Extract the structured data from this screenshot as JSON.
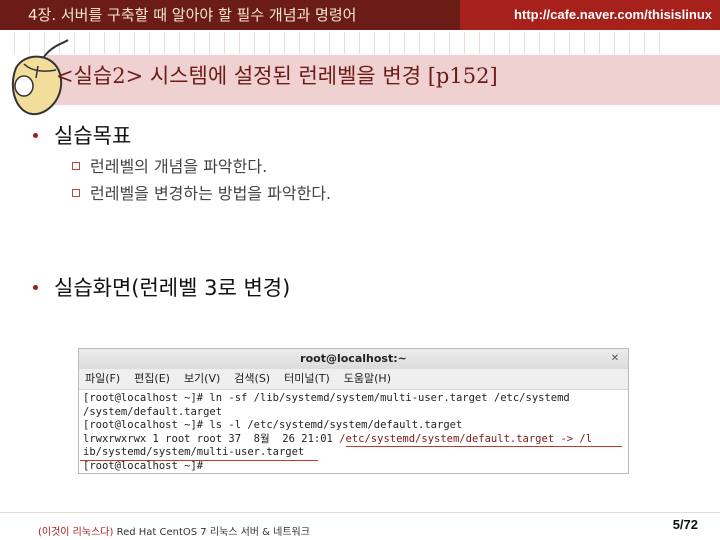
{
  "header": {
    "chapter": "4장. 서버를 구축할 때 알아야 할 필수 개념과 명령어",
    "url": "http://cafe.naver.com/thisislinux",
    "left_color": "#6b1c17",
    "right_color": "#a7211c"
  },
  "title": "<실습2> 시스템에 설정된 런레벨을 변경 [p152]",
  "section1": {
    "heading": "실습목표",
    "items": [
      "런레벨의 개념을 파악한다.",
      "런레벨을 변경하는 방법을 파악한다."
    ]
  },
  "section2": {
    "heading": "실습화면(런레벨 3로 변경)"
  },
  "terminal": {
    "title": "root@localhost:~",
    "close_icon": "close-icon",
    "menu": [
      "파일(F)",
      "편집(E)",
      "보기(V)",
      "검색(S)",
      "터미널(T)",
      "도움말(H)"
    ],
    "lines": [
      "[root@localhost ~]# ln -sf /lib/systemd/system/multi-user.target /etc/systemd",
      "/system/default.target",
      "[root@localhost ~]# ls -l /etc/systemd/system/default.target",
      "lrwxrwxrwx 1 root root 37  8월  26 21:01 ",
      "ib/systemd/system/multi-user.target",
      "[root@localhost ~]# "
    ],
    "highlight": "/etc/systemd/system/default.target -> /l"
  },
  "footer": {
    "brand": "(이것이 리눅스다)",
    "text": " Red Hat CentOS 7 리눅스 서버 & 네트워크",
    "page": "5/72"
  }
}
